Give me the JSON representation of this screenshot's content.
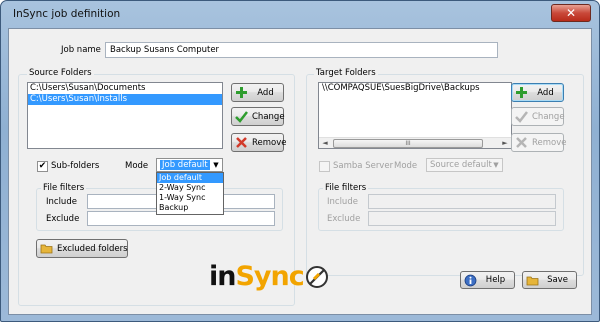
{
  "window": {
    "title": "InSync job definition",
    "close_glyph": "✕"
  },
  "job": {
    "label": "Job name",
    "value": "Backup Susans Computer"
  },
  "source": {
    "group_label": "Source Folders",
    "items": [
      {
        "text": "C:\\Users\\Susan\\Documents",
        "selected": false
      },
      {
        "text": "C:\\Users\\Susan\\Installs",
        "selected": true
      }
    ],
    "add_label": "Add",
    "change_label": "Change",
    "remove_label": "Remove",
    "subfolders_label": "Sub-folders",
    "subfolders_checked": "✔",
    "mode_label": "Mode",
    "mode_value": "Job default",
    "mode_options": [
      "Job default",
      "2-Way Sync",
      "1-Way Sync",
      "Backup"
    ],
    "filters": {
      "label": "File filters",
      "include_label": "Include",
      "include_value": "",
      "exclude_label": "Exclude",
      "exclude_value": ""
    },
    "excluded_label": "Excluded folders"
  },
  "target": {
    "group_label": "Target Folders",
    "items": [
      {
        "text": "\\\\COMPAQSUE\\SuesBigDrive\\Backups",
        "selected": false
      }
    ],
    "scroll_left": "◄",
    "scroll_right": "►",
    "scroll_grip": "III",
    "add_label": "Add",
    "change_label": "Change",
    "remove_label": "Remove",
    "samba_label": "Samba Server",
    "mode_label": "Mode",
    "mode_value": "Source default",
    "filters": {
      "label": "File filters",
      "include_label": "Include",
      "include_value": "",
      "exclude_label": "Exclude",
      "exclude_value": ""
    }
  },
  "footer": {
    "logo_text_in": "in",
    "logo_text_sync": "Sync",
    "help_label": "Help",
    "save_label": "Save"
  },
  "colors": {
    "accent": "#3399ff",
    "logo_orange": "#f2a400",
    "add_icon": "#2e9d2e",
    "remove_icon": "#d23a2a"
  }
}
